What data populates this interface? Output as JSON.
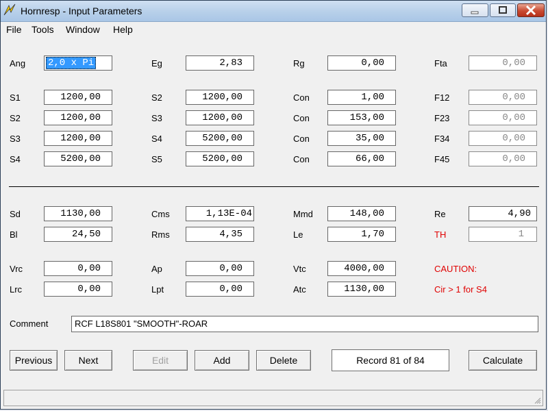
{
  "window": {
    "title": "Hornresp - Input Parameters"
  },
  "menu": {
    "file": "File",
    "tools": "Tools",
    "window": "Window",
    "help": "Help"
  },
  "params": {
    "ang": {
      "label": "Ang",
      "value": "2,0 x Pi"
    },
    "eg": {
      "label": "Eg",
      "value": "2,83"
    },
    "rg": {
      "label": "Rg",
      "value": "0,00"
    },
    "fta": {
      "label": "Fta",
      "value": "0,00"
    },
    "rows": [
      {
        "a_label": "S1",
        "a_value": "1200,00",
        "b_label": "S2",
        "b_value": "1200,00",
        "c_label": "Con",
        "c_value": "1,00",
        "d_label": "F12",
        "d_value": "0,00"
      },
      {
        "a_label": "S2",
        "a_value": "1200,00",
        "b_label": "S3",
        "b_value": "1200,00",
        "c_label": "Con",
        "c_value": "153,00",
        "d_label": "F23",
        "d_value": "0,00"
      },
      {
        "a_label": "S3",
        "a_value": "1200,00",
        "b_label": "S4",
        "b_value": "5200,00",
        "c_label": "Con",
        "c_value": "35,00",
        "d_label": "F34",
        "d_value": "0,00"
      },
      {
        "a_label": "S4",
        "a_value": "5200,00",
        "b_label": "S5",
        "b_value": "5200,00",
        "c_label": "Con",
        "c_value": "66,00",
        "d_label": "F45",
        "d_value": "0,00"
      }
    ]
  },
  "driver": {
    "sd": {
      "label": "Sd",
      "value": "1130,00"
    },
    "cms": {
      "label": "Cms",
      "value": "1,13E-04"
    },
    "mmd": {
      "label": "Mmd",
      "value": "148,00"
    },
    "re": {
      "label": "Re",
      "value": "4,90"
    },
    "bl": {
      "label": "Bl",
      "value": "24,50"
    },
    "rms": {
      "label": "Rms",
      "value": "4,35"
    },
    "le": {
      "label": "Le",
      "value": "1,70"
    },
    "th": {
      "label": "TH",
      "value": "1"
    },
    "vrc": {
      "label": "Vrc",
      "value": "0,00"
    },
    "ap": {
      "label": "Ap",
      "value": "0,00"
    },
    "vtc": {
      "label": "Vtc",
      "value": "4000,00"
    },
    "lrc": {
      "label": "Lrc",
      "value": "0,00"
    },
    "lpt": {
      "label": "Lpt",
      "value": "0,00"
    },
    "atc": {
      "label": "Atc",
      "value": "1130,00"
    }
  },
  "caution": {
    "title": "CAUTION:",
    "message": "Cir > 1 for S4"
  },
  "comment": {
    "label": "Comment",
    "value": "RCF L18S801 \"SMOOTH\"-ROAR"
  },
  "buttons": {
    "previous": "Previous",
    "next": "Next",
    "edit": "Edit",
    "add": "Add",
    "delete": "Delete",
    "calculate": "Calculate"
  },
  "record": "Record 81 of 84",
  "colors": {
    "warning": "#e00000",
    "selection": "#3399ff"
  }
}
